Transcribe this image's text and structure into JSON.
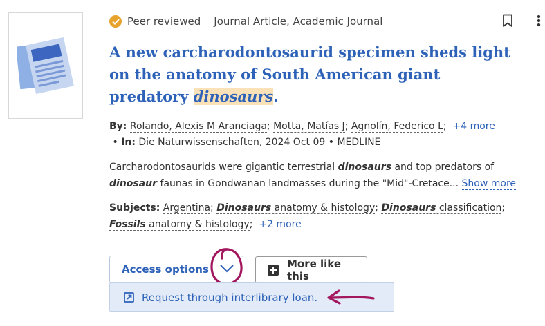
{
  "status": {
    "badge": "Peer reviewed",
    "doc_type": "Journal Article, Academic Journal"
  },
  "title": {
    "before": "A new carcharodontosaurid specimen sheds light on the anatomy of South American giant predatory ",
    "highlight": "dinosaurs",
    "after": "."
  },
  "byline": {
    "by_label": "By:",
    "authors": [
      "Rolando, Alexis M Aranciaga",
      "Motta, Matías J",
      "Agnolín, Federico L"
    ],
    "more_authors": "+4 more",
    "in_label": "In:",
    "source": "Die Naturwissenschaften, 2024 Oct 09",
    "database": "MEDLINE"
  },
  "abstract": {
    "t1": "Carcharodontosaurids were gigantic terrestrial ",
    "h1": "dinosaurs",
    "t2": " and top predators of ",
    "h2": "dinosaur",
    "t3": " faunas in Gondwanan landmasses during the \"Mid\"-Cretace...",
    "show_more": "Show more"
  },
  "subjects": {
    "label": "Subjects:",
    "s1": "Argentina",
    "s2_bold": "Dinosaurs",
    "s2_rest": " anatomy & histology",
    "s3_bold": "Dinosaurs",
    "s3_rest": " classification",
    "s4_bold": "Fossils",
    "s4_rest": " anatomy & histology",
    "more": "+2 more"
  },
  "actions": {
    "access_label": "Access options",
    "more_like_label": "More like this",
    "ill_label": "Request through interlibrary loan."
  },
  "colors": {
    "link": "#2d62b8",
    "highlight": "#fbe1b8",
    "badge": "#e8a32e",
    "annotation": "#a3175f",
    "dropdown_bg": "#e2ebf7"
  },
  "icons": {
    "thumbnail": "document-icon",
    "badge": "checkmark-badge-icon",
    "bookmark": "bookmark-icon",
    "menu": "kebab-menu-icon",
    "access_toggle": "chevron-down-icon",
    "more_like": "more-like-this-icon",
    "external": "external-link-icon"
  }
}
